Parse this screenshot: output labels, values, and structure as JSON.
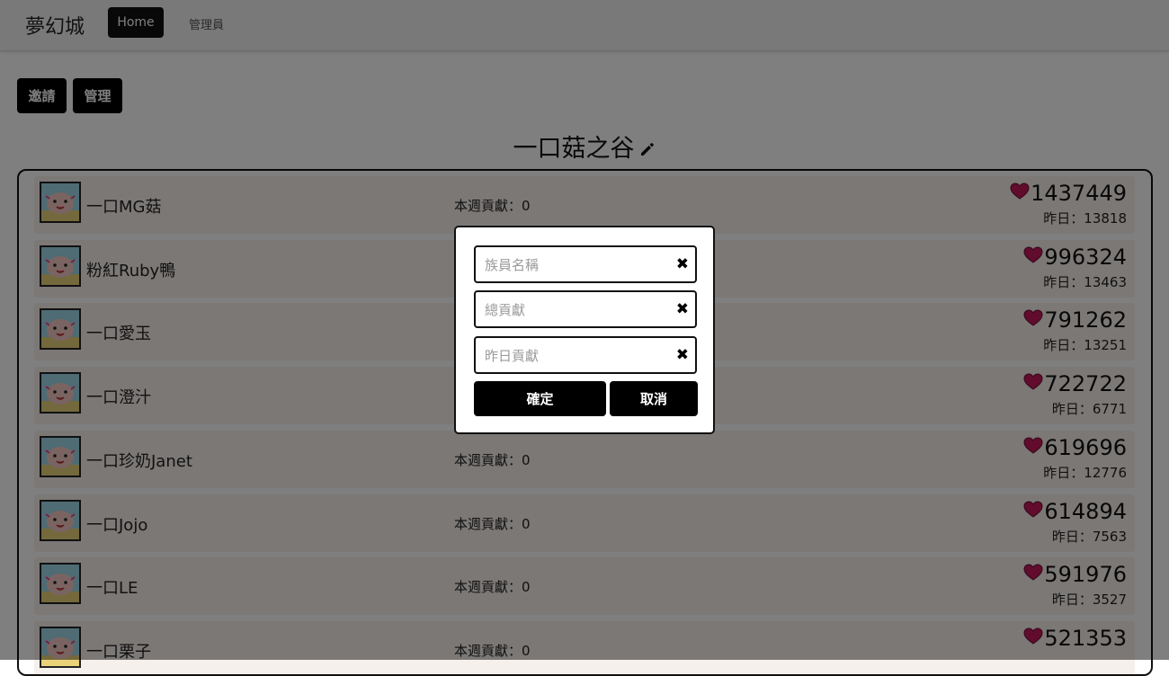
{
  "nav": {
    "brand": "夢幻城",
    "home": "Home",
    "admin": "管理員"
  },
  "actions": {
    "invite": "邀請",
    "manage": "管理"
  },
  "guild": {
    "title": "一口菇之谷"
  },
  "members": [
    {
      "name": "一口MG菇",
      "weekly": "本週貢獻：0",
      "total": "1437449",
      "yesterday": "昨日：13818"
    },
    {
      "name": "粉紅Ruby鴨",
      "weekly": "本週貢獻：0",
      "total": "996324",
      "yesterday": "昨日：13463"
    },
    {
      "name": "一口愛玉",
      "weekly": "本週貢獻：0",
      "total": "791262",
      "yesterday": "昨日：13251"
    },
    {
      "name": "一口澄汁",
      "weekly": "本週貢獻：0",
      "total": "722722",
      "yesterday": "昨日：6771"
    },
    {
      "name": "一口珍奶Janet",
      "weekly": "本週貢獻：0",
      "total": "619696",
      "yesterday": "昨日：12776"
    },
    {
      "name": "一口Jojo",
      "weekly": "本週貢獻：0",
      "total": "614894",
      "yesterday": "昨日：7563"
    },
    {
      "name": "一口LE",
      "weekly": "本週貢獻：0",
      "total": "591976",
      "yesterday": "昨日：3527"
    },
    {
      "name": "一口栗子",
      "weekly": "本週貢獻：0",
      "total": "521353",
      "yesterday": ""
    }
  ],
  "modal": {
    "name_placeholder": "族員名稱",
    "total_placeholder": "總貢獻",
    "yesterday_placeholder": "昨日貢獻",
    "name_value": "",
    "total_value": "",
    "yesterday_value": "",
    "confirm": "確定",
    "cancel": "取消"
  },
  "colors": {
    "accent": "#000000",
    "heart": "#c2185b",
    "row_bg": "#f6f0ec",
    "overlay": "rgba(0,0,0,0.5)"
  },
  "icons": {
    "edit": "pencil-icon",
    "contribution": "heart-icon",
    "clear": "close-icon"
  }
}
